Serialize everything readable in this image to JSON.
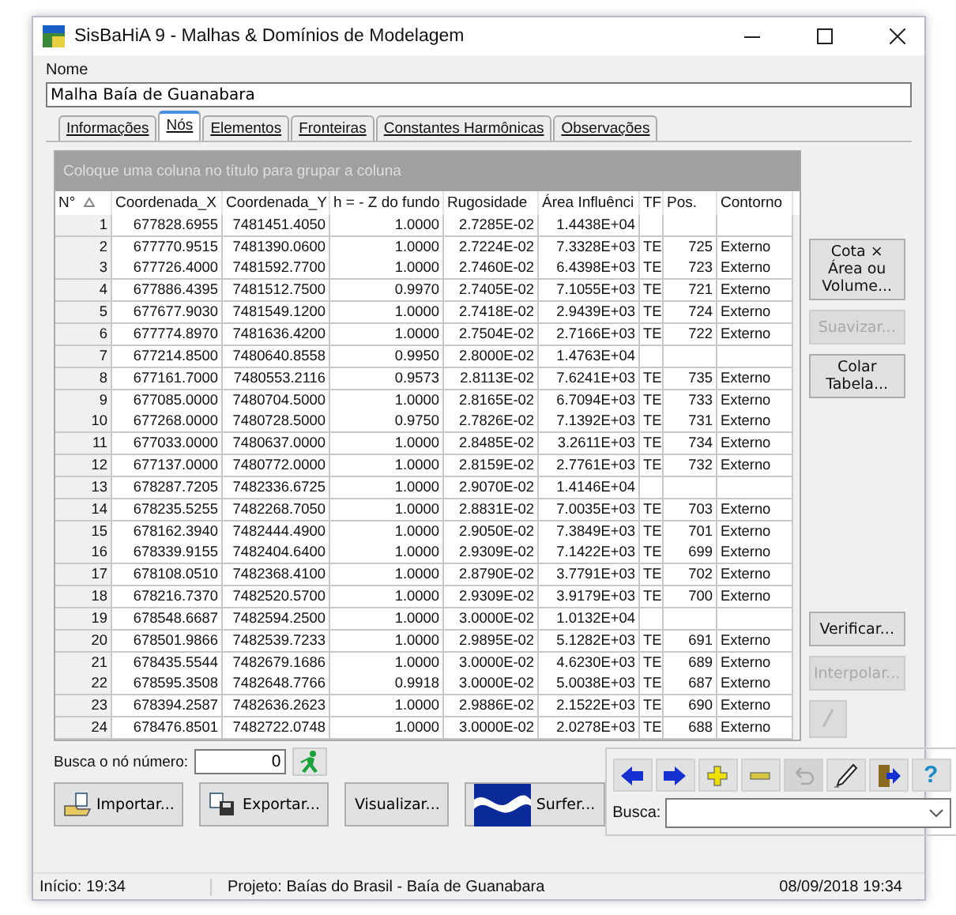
{
  "window": {
    "title": "SisBaHiA 9 - Malhas & Domínios de Modelagem"
  },
  "name_field": {
    "label": "Nome",
    "value": "Malha Baía de Guanabara"
  },
  "tabs": [
    {
      "label": "Informações",
      "selected": false
    },
    {
      "label": "Nós",
      "selected": true
    },
    {
      "label": "Elementos",
      "selected": false
    },
    {
      "label": "Fronteiras",
      "selected": false
    },
    {
      "label": "Constantes Harmônicas",
      "selected": false
    },
    {
      "label": "Observações",
      "selected": false
    }
  ],
  "grid": {
    "group_hint": "Coloque uma coluna no título para grupar a coluna",
    "columns": [
      {
        "label": "N°",
        "sorted": true
      },
      {
        "label": "Coordenada_X"
      },
      {
        "label": "Coordenada_Y"
      },
      {
        "label": "h = - Z do fundo"
      },
      {
        "label": "Rugosidade"
      },
      {
        "label": "Área Influênci"
      },
      {
        "label": "TF"
      },
      {
        "label": "Pos."
      },
      {
        "label": "Contorno"
      }
    ],
    "rows": [
      [
        "1",
        "677828.6955",
        "7481451.4050",
        "1.0000",
        "2.7285E-02",
        "1.4438E+04"
      ],
      [
        "2",
        "677770.9515",
        "7481390.0600",
        "1.0000",
        "2.7224E-02",
        "7.3328E+03",
        "TE",
        "725",
        "Externo"
      ],
      [
        "3",
        "677726.4000",
        "7481592.7700",
        "1.0000",
        "2.7460E-02",
        "6.4398E+03",
        "TE",
        "723",
        "Externo"
      ],
      [
        "4",
        "677886.4395",
        "7481512.7500",
        "0.9970",
        "2.7405E-02",
        "7.1055E+03",
        "TE",
        "721",
        "Externo"
      ],
      [
        "5",
        "677677.9030",
        "7481549.1200",
        "1.0000",
        "2.7418E-02",
        "2.9439E+03",
        "TE",
        "724",
        "Externo"
      ],
      [
        "6",
        "677774.8970",
        "7481636.4200",
        "1.0000",
        "2.7504E-02",
        "2.7166E+03",
        "TE",
        "722",
        "Externo"
      ],
      [
        "7",
        "677214.8500",
        "7480640.8558",
        "0.9950",
        "2.8000E-02",
        "1.4763E+04"
      ],
      [
        "8",
        "677161.7000",
        "7480553.2116",
        "0.9573",
        "2.8113E-02",
        "7.6241E+03",
        "TE",
        "735",
        "Externo"
      ],
      [
        "9",
        "677085.0000",
        "7480704.5000",
        "1.0000",
        "2.8165E-02",
        "6.7094E+03",
        "TE",
        "733",
        "Externo"
      ],
      [
        "10",
        "677268.0000",
        "7480728.5000",
        "0.9750",
        "2.7826E-02",
        "7.1392E+03",
        "TE",
        "731",
        "Externo"
      ],
      [
        "11",
        "677033.0000",
        "7480637.0000",
        "1.0000",
        "2.8485E-02",
        "3.2611E+03",
        "TE",
        "734",
        "Externo"
      ],
      [
        "12",
        "677137.0000",
        "7480772.0000",
        "1.0000",
        "2.8159E-02",
        "2.7761E+03",
        "TE",
        "732",
        "Externo"
      ],
      [
        "13",
        "678287.7205",
        "7482336.6725",
        "1.0000",
        "2.9070E-02",
        "1.4146E+04"
      ],
      [
        "14",
        "678235.5255",
        "7482268.7050",
        "1.0000",
        "2.8831E-02",
        "7.0035E+03",
        "TE",
        "703",
        "Externo"
      ],
      [
        "15",
        "678162.3940",
        "7482444.4900",
        "1.0000",
        "2.9050E-02",
        "7.3849E+03",
        "TE",
        "701",
        "Externo"
      ],
      [
        "16",
        "678339.9155",
        "7482404.6400",
        "1.0000",
        "2.9309E-02",
        "7.1422E+03",
        "TE",
        "699",
        "Externo"
      ],
      [
        "17",
        "678108.0510",
        "7482368.4100",
        "1.0000",
        "2.8790E-02",
        "3.7791E+03",
        "TE",
        "702",
        "Externo"
      ],
      [
        "18",
        "678216.7370",
        "7482520.5700",
        "1.0000",
        "2.9309E-02",
        "3.9179E+03",
        "TE",
        "700",
        "Externo"
      ],
      [
        "19",
        "678548.6687",
        "7482594.2500",
        "1.0000",
        "3.0000E-02",
        "1.0132E+04"
      ],
      [
        "20",
        "678501.9866",
        "7482539.7233",
        "1.0000",
        "2.9895E-02",
        "5.1282E+03",
        "TE",
        "691",
        "Externo"
      ],
      [
        "21",
        "678435.5544",
        "7482679.1686",
        "1.0000",
        "3.0000E-02",
        "4.6230E+03",
        "TE",
        "689",
        "Externo"
      ],
      [
        "22",
        "678595.3508",
        "7482648.7766",
        "0.9918",
        "3.0000E-02",
        "5.0038E+03",
        "TE",
        "687",
        "Externo"
      ],
      [
        "23",
        "678394.2587",
        "7482636.2623",
        "1.0000",
        "2.9886E-02",
        "2.1522E+03",
        "TE",
        "690",
        "Externo"
      ],
      [
        "24",
        "678476.8501",
        "7482722.0748",
        "1.0000",
        "3.0000E-02",
        "2.0278E+03",
        "TE",
        "688",
        "Externo"
      ]
    ]
  },
  "side_buttons_top": [
    {
      "label": "Cota × Área ou Volume...",
      "disabled": false
    },
    {
      "label": "Suavizar...",
      "disabled": true
    },
    {
      "label": "Colar Tabela...",
      "disabled": false
    }
  ],
  "side_buttons_bottom": [
    {
      "kind": "text",
      "label": "Verificar...",
      "disabled": false
    },
    {
      "kind": "text",
      "label": "Interpolar...",
      "disabled": true
    },
    {
      "kind": "pencil",
      "disabled": true
    }
  ],
  "node_search": {
    "label": "Busca o nó número:",
    "value": "0"
  },
  "actions": [
    {
      "kind": "import",
      "label": "Importar..."
    },
    {
      "kind": "export",
      "label": "Exportar..."
    },
    {
      "kind": "plain",
      "label": "Visualizar..."
    },
    {
      "kind": "surfer",
      "label": "Surfer..."
    }
  ],
  "toolbar": {
    "buttons": [
      {
        "kind": "back",
        "disabled": false
      },
      {
        "kind": "forward",
        "disabled": false
      },
      {
        "kind": "add",
        "disabled": false
      },
      {
        "kind": "remove",
        "disabled": false
      },
      {
        "kind": "undo",
        "disabled": true
      },
      {
        "kind": "edit",
        "disabled": false
      },
      {
        "kind": "exit",
        "disabled": false
      },
      {
        "kind": "help",
        "glyph": "?",
        "disabled": false
      }
    ],
    "search_label": "Busca:"
  },
  "status_bar": [
    {
      "text": "Início: 19:34"
    },
    {
      "text": "Projeto: Baías do Brasil - Baía de Guanabara"
    },
    {
      "text": "08/09/2018 19:34"
    }
  ]
}
